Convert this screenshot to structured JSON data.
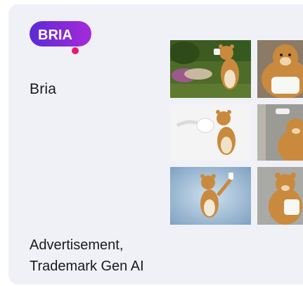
{
  "brand": {
    "logo_text": "BRIA",
    "name": "Bria"
  },
  "tags": {
    "line1": "Advertisement,",
    "line2": "Trademark Gen AI"
  },
  "colors": {
    "card_background": "#eff1f6",
    "logo_gradient_start": "#5b2bd6",
    "logo_gradient_end": "#b32bd6",
    "logo_dot": "#e5197a"
  },
  "gallery": [
    {
      "subject": "bear-with-toilet-paper-garden-photo"
    },
    {
      "subject": "bear-hugging-toilet-paper-closeup"
    },
    {
      "subject": "bear-with-flying-toilet-roll-white-bg"
    },
    {
      "subject": "bear-holding-toilet-paper-gray-bg"
    },
    {
      "subject": "bear-waving-blue-studio-bg"
    },
    {
      "subject": "bear-with-toilet-paper-gray-studio"
    }
  ]
}
